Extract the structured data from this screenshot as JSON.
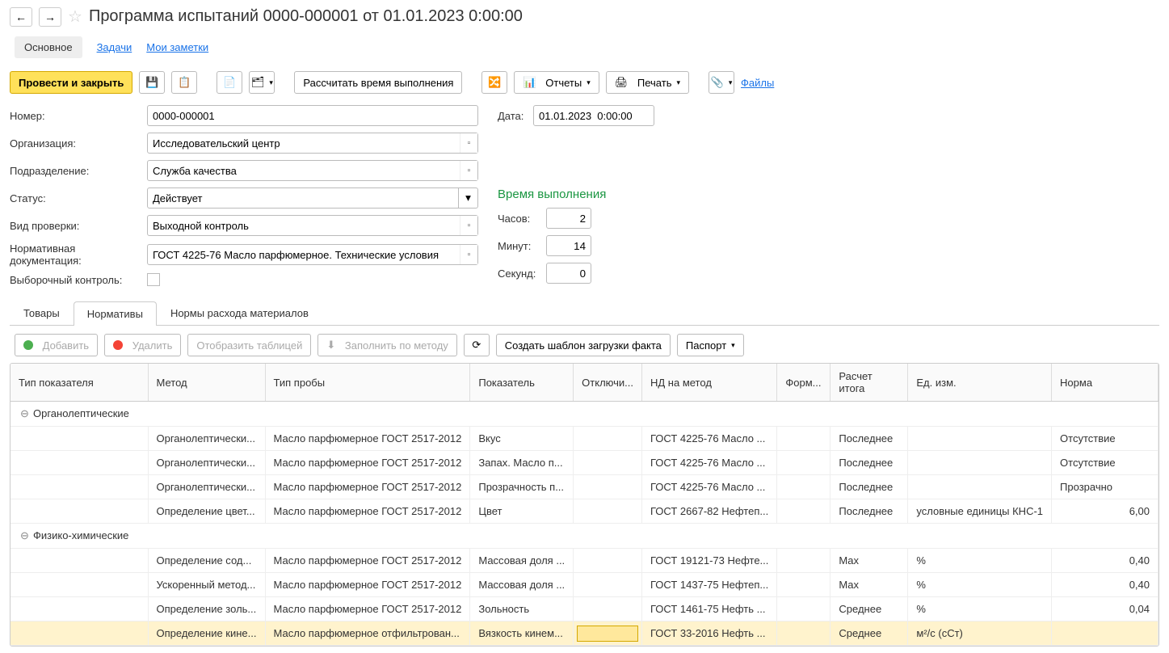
{
  "header": {
    "title": "Программа испытаний 0000-000001 от 01.01.2023 0:00:00"
  },
  "topTabs": {
    "main": "Основное",
    "tasks": "Задачи",
    "notes": "Мои заметки"
  },
  "toolbar": {
    "postClose": "Провести и закрыть",
    "calc": "Рассчитать время выполнения",
    "reports": "Отчеты",
    "print": "Печать",
    "files": "Файлы"
  },
  "form": {
    "numberLabel": "Номер:",
    "numberValue": "0000-000001",
    "dateLabel": "Дата:",
    "dateValue": "01.01.2023  0:00:00",
    "orgLabel": "Организация:",
    "orgValue": "Исследовательский центр",
    "deptLabel": "Подразделение:",
    "deptValue": "Служба качества",
    "statusLabel": "Статус:",
    "statusValue": "Действует",
    "checkTypeLabel": "Вид проверки:",
    "checkTypeValue": "Выходной контроль",
    "normDocLabel": "Нормативная документация:",
    "normDocValue": "ГОСТ 4225-76 Масло парфюмерное. Технические условия",
    "selectiveLabel": "Выборочный контроль:"
  },
  "time": {
    "heading": "Время выполнения",
    "hoursLabel": "Часов:",
    "hoursValue": "2",
    "minutesLabel": "Минут:",
    "minutesValue": "14",
    "secondsLabel": "Секунд:",
    "secondsValue": "0"
  },
  "subTabs": {
    "goods": "Товары",
    "norms": "Нормативы",
    "materials": "Нормы расхода материалов"
  },
  "tableToolbar": {
    "add": "Добавить",
    "delete": "Удалить",
    "showTable": "Отобразить таблицей",
    "fillByMethod": "Заполнить по методу",
    "createTemplate": "Создать шаблон загрузки факта",
    "passport": "Паспорт"
  },
  "columns": {
    "c0": "Тип показателя",
    "c1": "Метод",
    "c2": "Тип пробы",
    "c3": "Показатель",
    "c4": "Отключи...",
    "c5": "НД на метод",
    "c6": "Форм...",
    "c7": "Расчет итога",
    "c8": "Ед. изм.",
    "c9": "Норма"
  },
  "groups": {
    "g1": "Органолептические",
    "g2": "Физико-химические"
  },
  "rows": [
    {
      "method": "Органолептически...",
      "sample": "Масло парфюмерное ГОСТ 2517-2012",
      "indicator": "Вкус",
      "nd": "ГОСТ 4225-76 Масло ...",
      "calc": "Последнее",
      "unit": "",
      "norm": "Отсутствие"
    },
    {
      "method": "Органолептически...",
      "sample": "Масло парфюмерное ГОСТ 2517-2012",
      "indicator": "Запах. Масло п...",
      "nd": "ГОСТ 4225-76 Масло ...",
      "calc": "Последнее",
      "unit": "",
      "norm": "Отсутствие"
    },
    {
      "method": "Органолептически...",
      "sample": "Масло парфюмерное ГОСТ 2517-2012",
      "indicator": "Прозрачность п...",
      "nd": "ГОСТ 4225-76 Масло ...",
      "calc": "Последнее",
      "unit": "",
      "norm": "Прозрачно"
    },
    {
      "method": "Определение цвет...",
      "sample": "Масло парфюмерное ГОСТ 2517-2012",
      "indicator": "Цвет",
      "nd": "ГОСТ 2667-82 Нефтеп...",
      "calc": "Последнее",
      "unit": "условные единицы КНС-1",
      "norm": "6,00"
    },
    {
      "method": "Определение сод...",
      "sample": "Масло парфюмерное ГОСТ 2517-2012",
      "indicator": "Массовая доля ...",
      "nd": "ГОСТ 19121-73 Нефте...",
      "calc": "Max",
      "unit": "%",
      "norm": "0,40"
    },
    {
      "method": "Ускоренный метод...",
      "sample": "Масло парфюмерное ГОСТ 2517-2012",
      "indicator": "Массовая доля ...",
      "nd": "ГОСТ 1437-75 Нефтеп...",
      "calc": "Max",
      "unit": "%",
      "norm": "0,40"
    },
    {
      "method": "Определение золь...",
      "sample": "Масло парфюмерное ГОСТ 2517-2012",
      "indicator": "Зольность",
      "nd": "ГОСТ 1461-75 Нефть ...",
      "calc": "Среднее",
      "unit": "%",
      "norm": "0,04"
    },
    {
      "method": "Определение кине...",
      "sample": "Масло парфюмерное отфильтрован...",
      "indicator": "Вязкость кинем...",
      "nd": "ГОСТ 33-2016 Нефть ...",
      "calc": "Среднее",
      "unit": "м²/с (сСт)",
      "norm": ""
    }
  ]
}
